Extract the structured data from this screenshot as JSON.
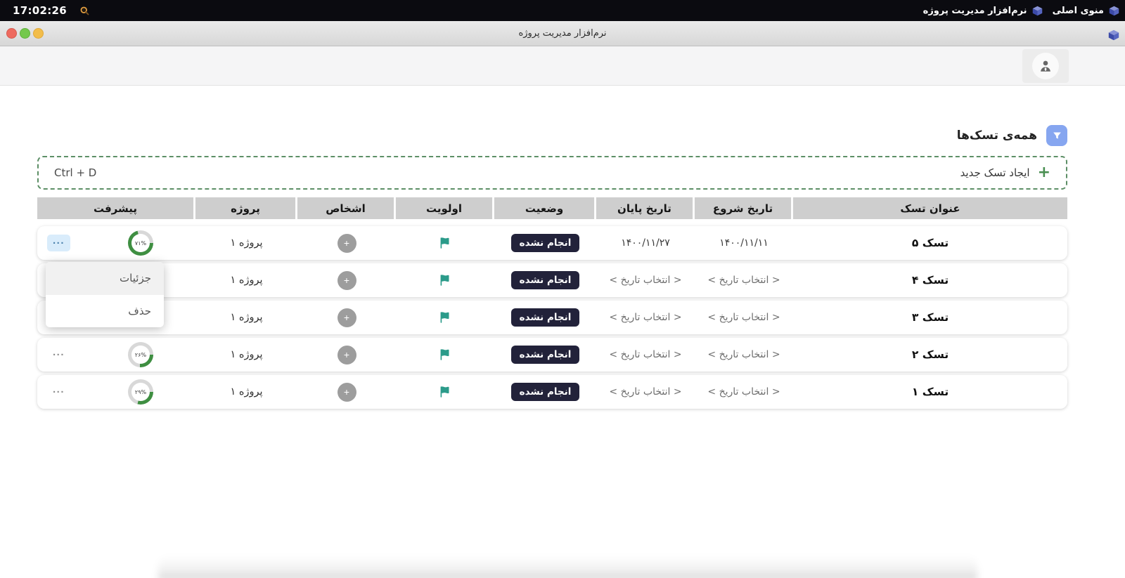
{
  "menubar": {
    "time": "17:02:26",
    "items": [
      {
        "label": "منوی اصلی"
      },
      {
        "label": "نرم‌افزار مدیریت پروژه"
      }
    ]
  },
  "window": {
    "title": "نرم‌افزار مدیریت پروژه"
  },
  "page": {
    "heading": "همه‌ی تسک‌ها",
    "create_task_label": "ایجاد تسک جدید",
    "create_task_shortcut": "Ctrl + D"
  },
  "icons": {
    "plus": "+",
    "more": "..."
  },
  "table": {
    "headers": [
      "عنوان تسک",
      "تاریخ شروع",
      "تاریخ پایان",
      "وضعیت",
      "اولویت",
      "اشخاص",
      "پروژه",
      "پیشرفت"
    ],
    "rows": [
      {
        "title": "تسک ۵",
        "start_date": "۱۴۰۰/۱۱/۱۱",
        "end_date": "۱۴۰۰/۱۱/۲۷",
        "status": "انجام نشده",
        "project": "پروژه ۱",
        "progress_label": "۷۱%",
        "progress_pct": 71
      },
      {
        "title": "تسک ۴",
        "start_date": "< انتخاب تاریخ >",
        "end_date": "< انتخاب تاریخ >",
        "status": "انجام نشده",
        "project": "پروژه ۱"
      },
      {
        "title": "تسک ۳",
        "start_date": "< انتخاب تاریخ >",
        "end_date": "< انتخاب تاریخ >",
        "status": "انجام نشده",
        "project": "پروژه ۱"
      },
      {
        "title": "تسک ۲",
        "start_date": "< انتخاب تاریخ >",
        "end_date": "< انتخاب تاریخ >",
        "status": "انجام نشده",
        "project": "پروژه ۱",
        "progress_label": "۲۶%",
        "progress_pct": 26
      },
      {
        "title": "تسک ۱",
        "start_date": "< انتخاب تاریخ >",
        "end_date": "< انتخاب تاریخ >",
        "status": "انجام نشده",
        "project": "پروژه ۱",
        "progress_label": "۲۹%",
        "progress_pct": 29
      }
    ]
  },
  "context_menu": {
    "items": [
      "جزئیات",
      "حذف"
    ]
  },
  "colors": {
    "menubar_bg": "#0b0b10",
    "accent_blue": "#86a6f0",
    "dash_green": "#5d8f66",
    "plus_green": "#4a8f52",
    "badge_bg": "#22223a",
    "flag_teal": "#2b9b8a",
    "progress_green": "#3e8e41",
    "ring_track": "#d8d8d8",
    "header_cell_bg": "#cecece",
    "more_highlight": "#d9ecfb",
    "traffic_red": "#ee6a5f",
    "traffic_green": "#74c84c",
    "traffic_yellow": "#f2bd4b"
  }
}
